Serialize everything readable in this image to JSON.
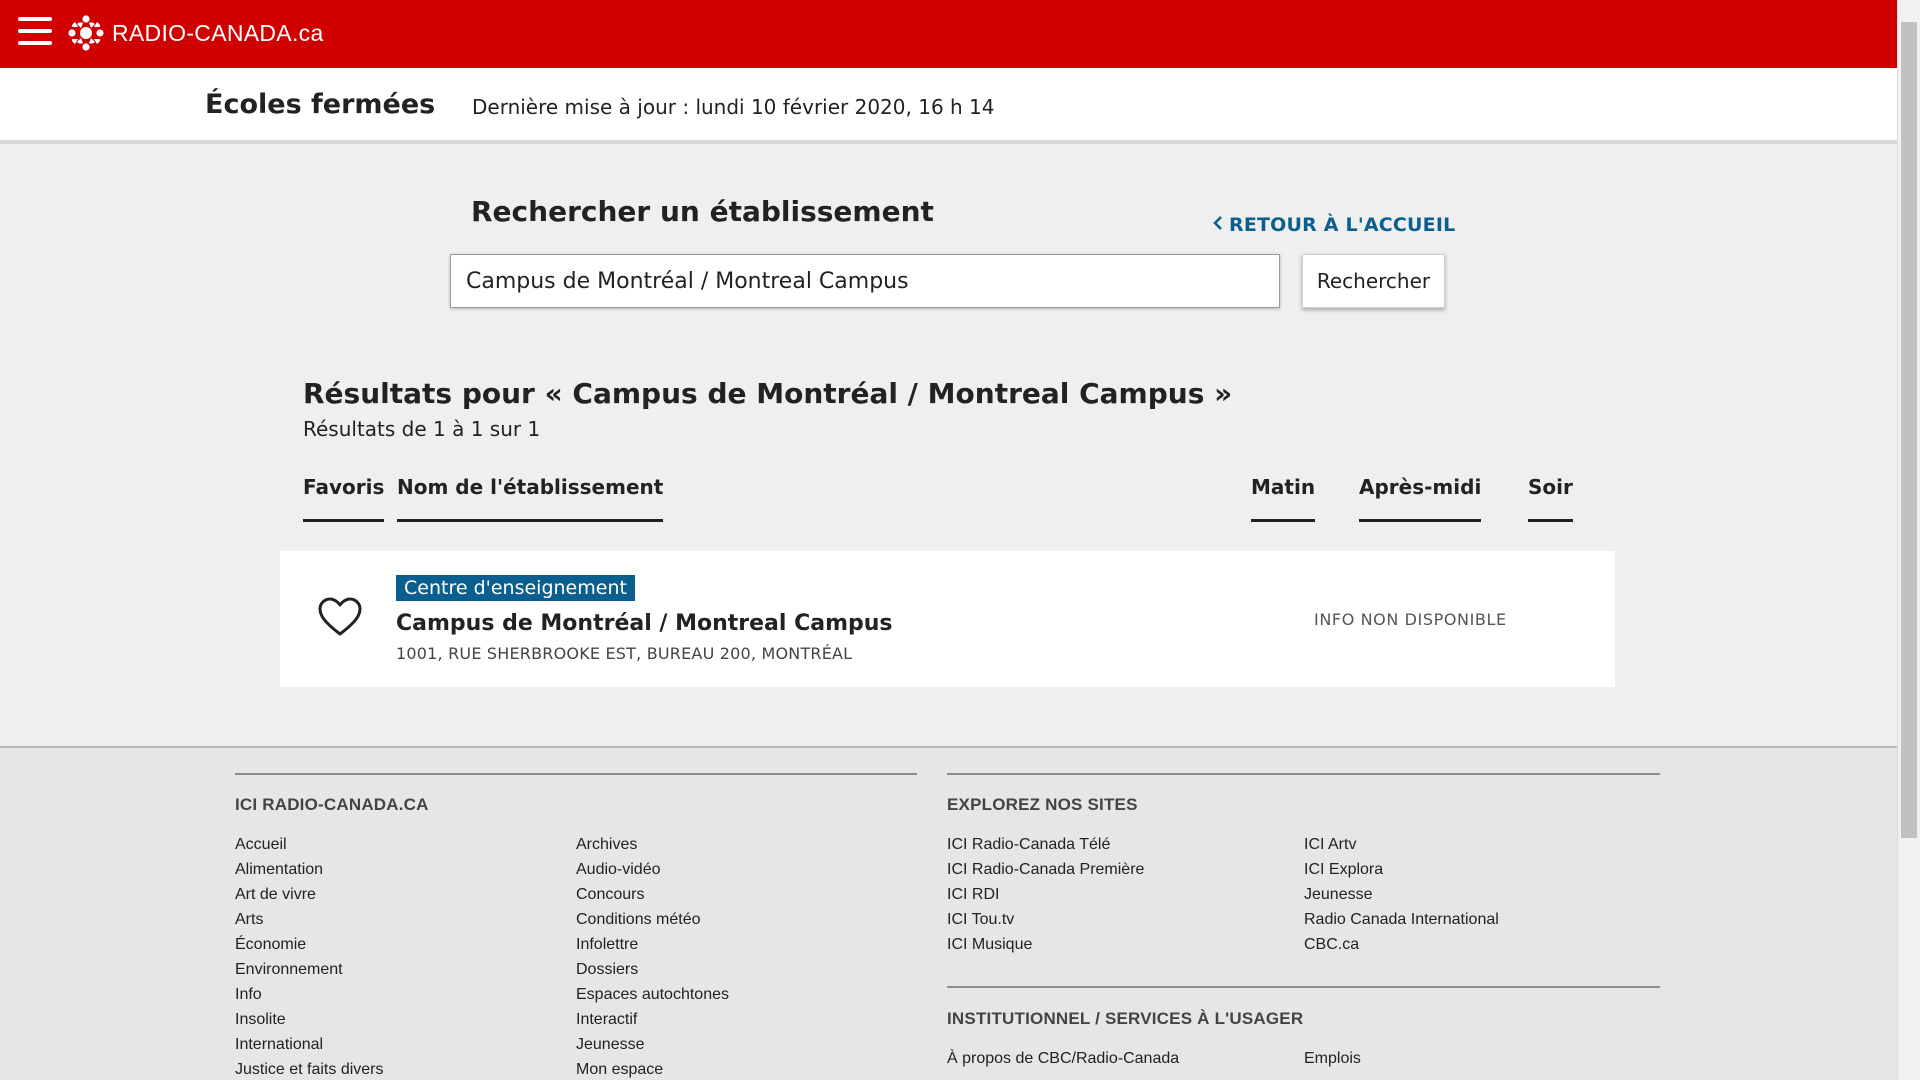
{
  "header": {
    "logo_text": "RADIO-CANADA.ca",
    "brand_color": "#d00000"
  },
  "subheader": {
    "title": "Écoles fermées",
    "last_update": "Dernière mise à jour : lundi 10 février 2020, 16 h 14"
  },
  "search": {
    "title": "Rechercher un établissement",
    "back_link": "RETOUR À L'ACCUEIL",
    "input_value": "Campus de Montréal / Montreal Campus",
    "button_label": "Rechercher"
  },
  "results": {
    "title": "Résultats pour « Campus de Montréal / Montreal Campus »",
    "count": "Résultats de 1 à 1 sur 1",
    "columns": {
      "favorites": "Favoris",
      "name": "Nom de l'établissement",
      "morning": "Matin",
      "afternoon": "Après-midi",
      "evening": "Soir"
    },
    "items": [
      {
        "category": "Centre d'enseignement",
        "name": "Campus de Montréal / Montreal Campus",
        "address": "1001, RUE SHERBROOKE EST, BUREAU 200, MONTRÉAL",
        "status": "INFO NON DISPONIBLE"
      }
    ],
    "badge_color": "#0b5f8f"
  },
  "footer": {
    "section1": {
      "heading": "ICI RADIO-CANADA.CA",
      "col1": [
        "Accueil",
        "Alimentation",
        "Art de vivre",
        "Arts",
        "Économie",
        "Environnement",
        "Info",
        "Insolite",
        "International",
        "Justice et faits divers"
      ],
      "col2": [
        "Archives",
        "Audio-vidéo",
        "Concours",
        "Conditions météo",
        "Infolettre",
        "Dossiers",
        "Espaces autochtones",
        "Interactif",
        "Jeunesse",
        "Mon espace"
      ]
    },
    "section2": {
      "heading": "EXPLOREZ NOS SITES",
      "col1": [
        "ICI Radio-Canada Télé",
        "ICI Radio-Canada Première",
        "ICI RDI",
        "ICI Tou.tv",
        "ICI Musique"
      ],
      "col2": [
        "ICI Artv",
        "ICI Explora",
        "Jeunesse",
        "Radio Canada International",
        "CBC.ca"
      ]
    },
    "section3": {
      "heading": "INSTITUTIONNEL / SERVICES À L'USAGER",
      "col1": [
        "À propos de CBC/Radio-Canada"
      ],
      "col2": [
        "Emplois"
      ]
    }
  }
}
